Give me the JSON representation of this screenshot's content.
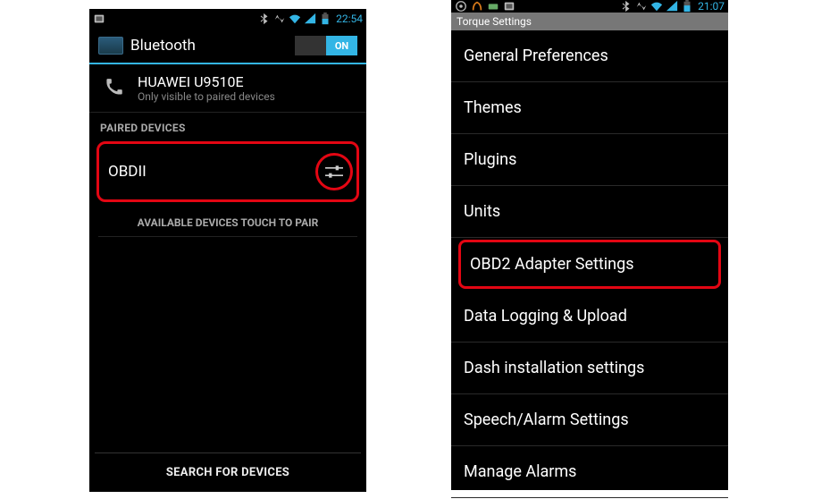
{
  "left": {
    "status": {
      "clock": "22:54"
    },
    "header": {
      "title": "Bluetooth",
      "toggle_on": "ON"
    },
    "device": {
      "name": "HUAWEI U9510E",
      "sub": "Only visible to paired devices"
    },
    "paired_label": "PAIRED DEVICES",
    "paired_device": "OBDII",
    "available_label": "AVAILABLE DEVICES   TOUCH TO PAIR",
    "search": "SEARCH FOR DEVICES"
  },
  "right": {
    "status": {
      "clock": "21:07"
    },
    "header": "Torque Settings",
    "items": [
      {
        "label": "General Preferences",
        "hl": false
      },
      {
        "label": "Themes",
        "hl": false
      },
      {
        "label": "Plugins",
        "hl": false
      },
      {
        "label": "Units",
        "hl": false
      },
      {
        "label": "OBD2 Adapter Settings",
        "hl": true
      },
      {
        "label": "Data Logging & Upload",
        "hl": false
      },
      {
        "label": "Dash installation settings",
        "hl": false
      },
      {
        "label": "Speech/Alarm Settings",
        "hl": false
      },
      {
        "label": "Manage Alarms",
        "hl": false
      }
    ]
  }
}
